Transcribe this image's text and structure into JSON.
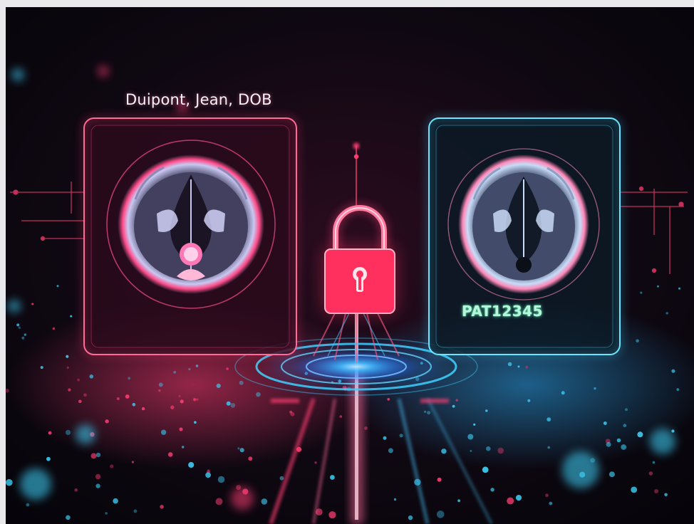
{
  "scene": {
    "identified_label": "Duipont, Jean, DOB",
    "anonymized_label": "PAT12345",
    "icons": {
      "identified_scan": "brain-ct-scan-icon",
      "anonymized_scan": "brain-ct-scan-icon",
      "lock": "padlock-icon",
      "portal": "circular-data-portal"
    },
    "colors": {
      "background": "#07060c",
      "identified_accent": "#ff3d73",
      "anonymized_accent": "#3fd6ff",
      "lock": "#ff2f5e",
      "label_highlight": "#b8f5d9"
    }
  }
}
